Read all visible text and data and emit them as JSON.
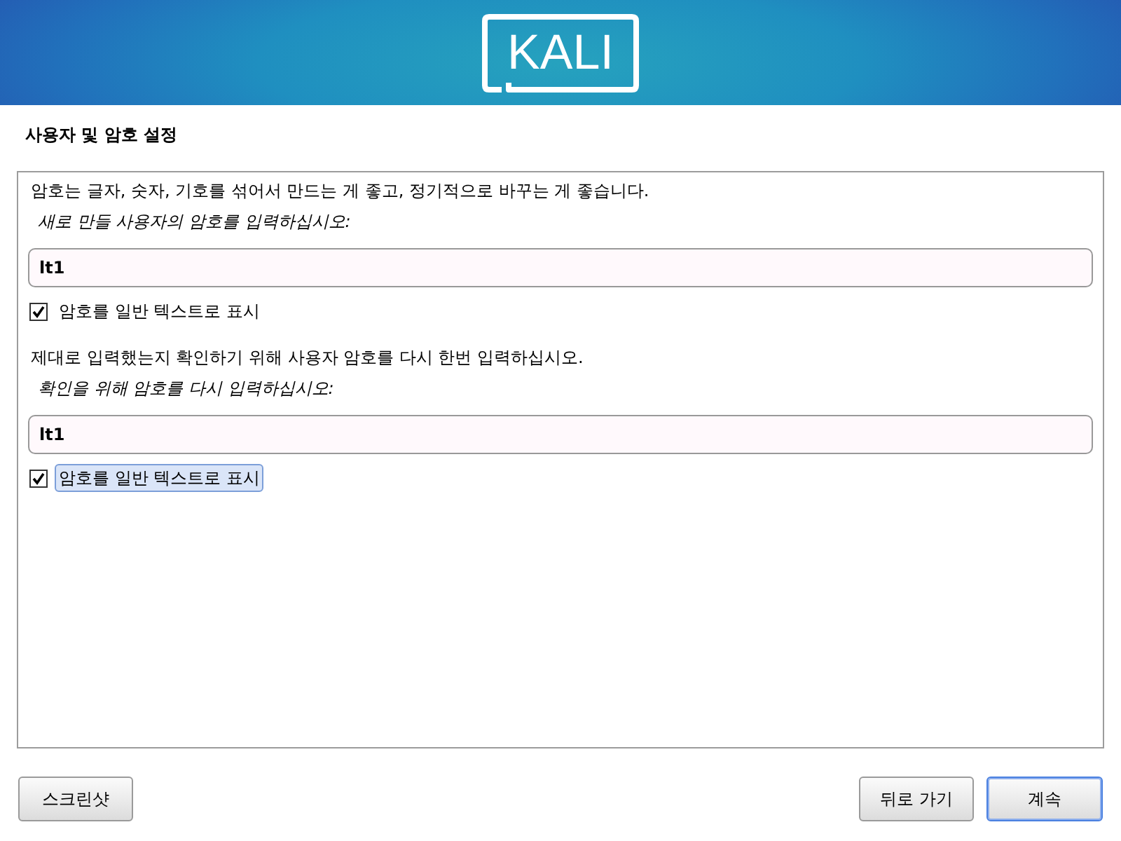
{
  "header": {
    "logo": "KALI"
  },
  "title": "사용자 및 암호 설정",
  "sections": [
    {
      "description": "암호는 글자, 숫자, 기호를 섞어서 만드는 게 좋고, 정기적으로 바꾸는 게 좋습니다.",
      "prompt": "새로 만들 사용자의 암호를 입력하십시오:",
      "password": {
        "value": "lt1"
      },
      "show_password": {
        "label": "암호를 일반 텍스트로 표시",
        "checked": true,
        "focused": false
      }
    },
    {
      "description": "제대로 입력했는지 확인하기 위해 사용자 암호를 다시 한번 입력하십시오.",
      "prompt": "확인을 위해 암호를 다시 입력하십시오:",
      "password": {
        "value": "lt1"
      },
      "show_password": {
        "label": "암호를 일반 텍스트로 표시",
        "checked": true,
        "focused": true
      }
    }
  ],
  "footer": {
    "left_buttons": [
      {
        "label": "스크린샷",
        "focused": false
      }
    ],
    "right_buttons": [
      {
        "label": "뒤로 가기",
        "focused": false
      },
      {
        "label": "계속",
        "focused": true
      }
    ]
  }
}
